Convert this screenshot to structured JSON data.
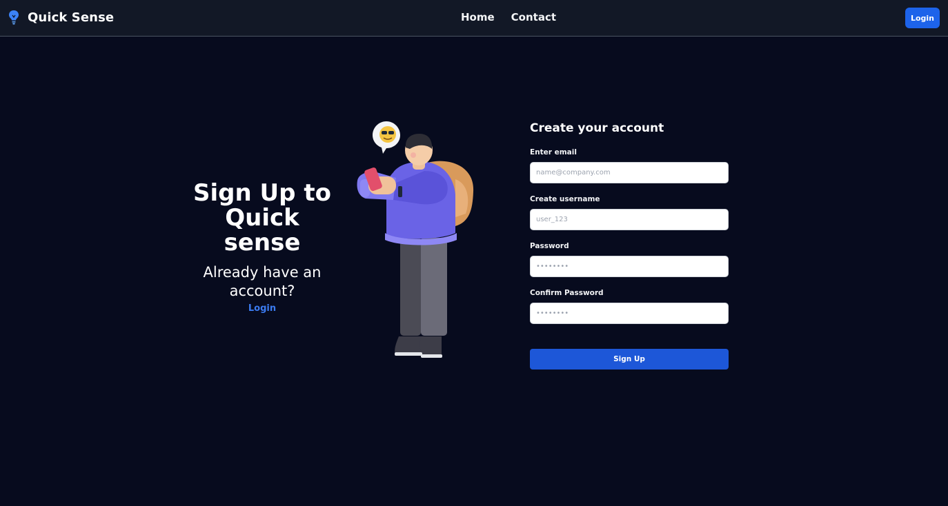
{
  "navbar": {
    "brand_name": "Quick Sense",
    "brand_icon": "lightbulb-icon",
    "links": [
      "Home",
      "Contact"
    ],
    "login_label": "Login"
  },
  "hero": {
    "title": "Sign Up to Quick sense",
    "subtitle": "Already have an account?",
    "login_link": "Login"
  },
  "form": {
    "title": "Create your account",
    "email_label": "Enter email",
    "email_placeholder": "name@company.com",
    "username_label": "Create username",
    "username_placeholder": "user_123",
    "password_label": "Password",
    "password_placeholder": "••••••••",
    "confirm_label": "Confirm Password",
    "confirm_placeholder": "••••••••",
    "submit_label": "Sign Up"
  },
  "colors": {
    "background": "#070b1e",
    "navbar": "#121826",
    "accent": "#1d63ea",
    "link": "#3b7bf0"
  }
}
